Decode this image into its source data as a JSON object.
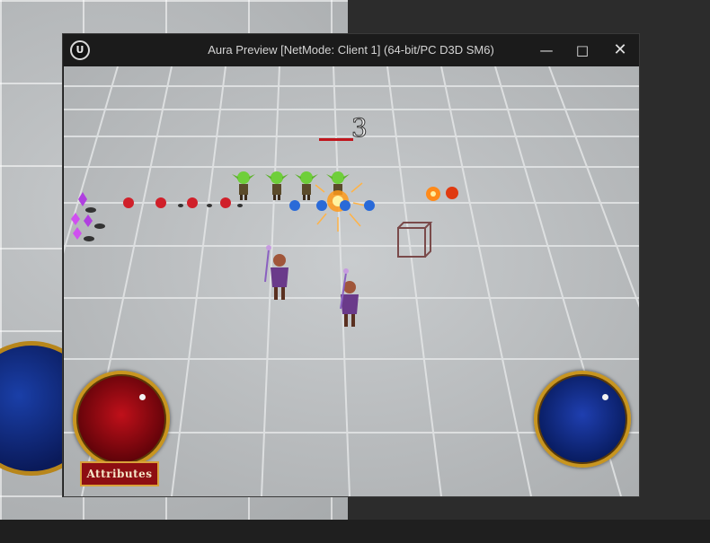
{
  "window": {
    "title": "Aura Preview [NetMode: Client 1]  (64-bit/PC D3D SM6)",
    "logo": "U",
    "controls": {
      "minimize": "—",
      "maximize": "□",
      "close": "✕"
    }
  },
  "hud": {
    "attributes_button": "Attributes",
    "damage_number": "3",
    "health_orb_color": "#b00d16",
    "mana_orb_color": "#1a3aa8"
  },
  "scene": {
    "enemies": [
      "goblin",
      "goblin",
      "goblin",
      "goblin"
    ],
    "characters": [
      "aura-player",
      "aura-player"
    ],
    "pickups": [
      "purple-crystal",
      "red-potion",
      "blue-potion",
      "fire-effect"
    ]
  }
}
